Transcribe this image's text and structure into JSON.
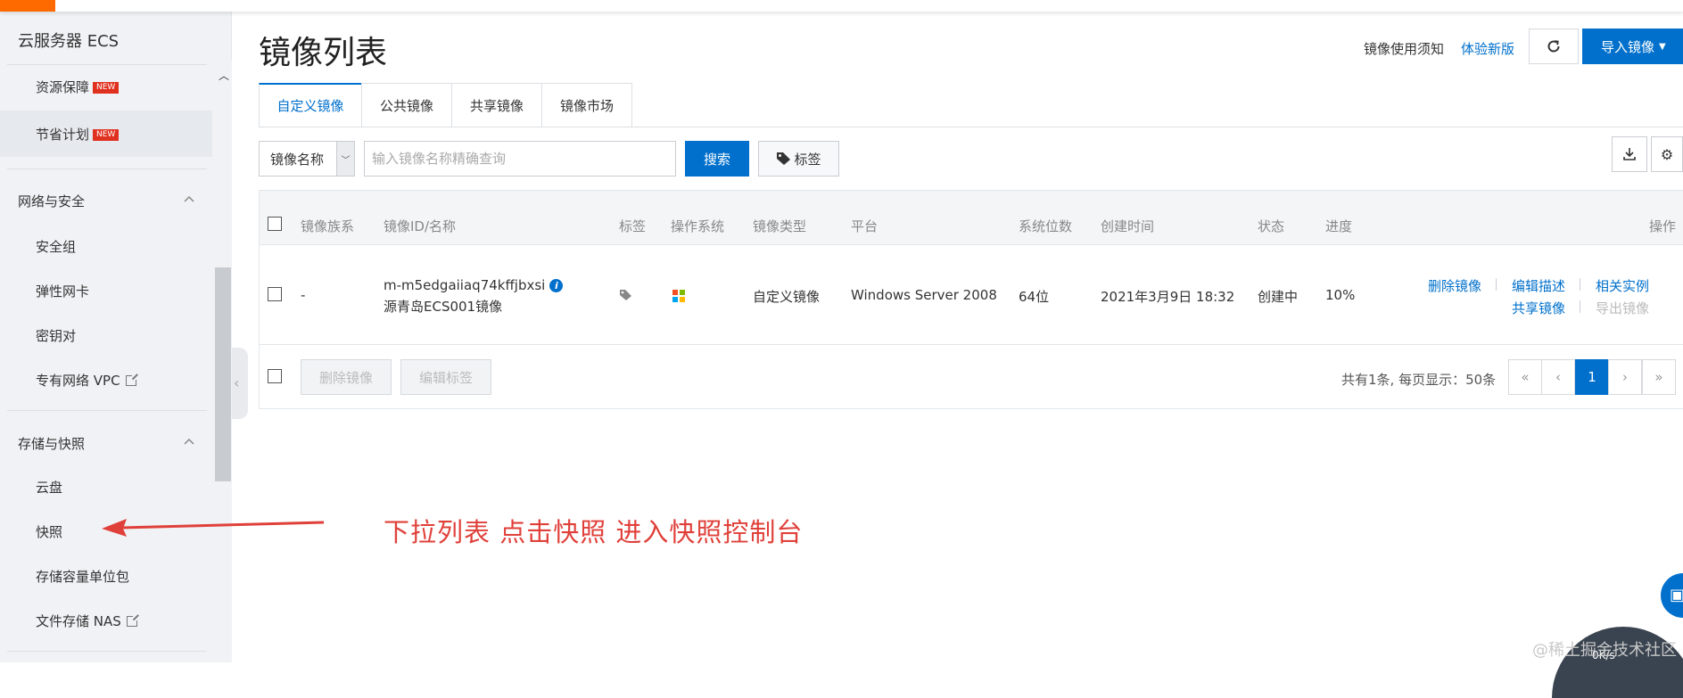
{
  "sidebar": {
    "title": "云服务器 ECS",
    "items_top": [
      {
        "label": "资源保障",
        "badge": "NEW"
      },
      {
        "label": "节省计划",
        "badge": "NEW"
      }
    ],
    "groups": [
      {
        "label": "网络与安全",
        "items": [
          "安全组",
          "弹性网卡",
          "密钥对",
          "专有网络 VPC"
        ]
      },
      {
        "label": "存储与快照",
        "items": [
          "云盘",
          "快照",
          "存储容量单位包",
          "文件存储 NAS"
        ]
      }
    ]
  },
  "header": {
    "title": "镜像列表",
    "notice_link": "镜像使用须知",
    "new_version_link": "体验新版",
    "import_label": "导入镜像"
  },
  "tabs": [
    "自定义镜像",
    "公共镜像",
    "共享镜像",
    "镜像市场"
  ],
  "search": {
    "select_value": "镜像名称",
    "placeholder": "输入镜像名称精确查询",
    "button": "搜索",
    "tag_button": "标签"
  },
  "table": {
    "columns": [
      "镜像族系",
      "镜像ID/名称",
      "标签",
      "操作系统",
      "镜像类型",
      "平台",
      "系统位数",
      "创建时间",
      "状态",
      "进度",
      "操作"
    ],
    "rows": [
      {
        "family": "-",
        "id": "m-m5edgaiiaq74kffjbxsi",
        "name": "源青岛ECS001镜像",
        "type": "自定义镜像",
        "platform": "Windows Server 2008",
        "bits": "64位",
        "created": "2021年3月9日 18:32",
        "status": "创建中",
        "progress": "10%",
        "actions": [
          "删除镜像",
          "编辑描述",
          "相关实例",
          "共享镜像",
          "导出镜像"
        ]
      }
    ]
  },
  "footer": {
    "delete_button": "删除镜像",
    "edit_tags_button": "编辑标签",
    "pager_text": "共有1条, 每页显示：50条",
    "pages": [
      "«",
      "‹",
      "1",
      "›",
      "»"
    ]
  },
  "annotation": "下拉列表 点击快照 进入快照控制台",
  "watermark": "@稀土掘金技术社区",
  "gauge_text": "0K/s",
  "colors": {
    "accent": "#0070cc",
    "brand": "#ff6a00",
    "annotation": "#e0403a"
  }
}
